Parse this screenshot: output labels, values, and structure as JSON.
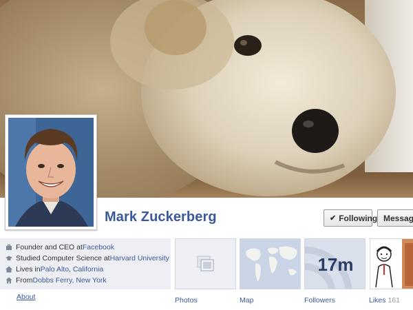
{
  "profile": {
    "name": "Mark Zuckerberg"
  },
  "actions": {
    "following_label": "Following",
    "message_label": "Message"
  },
  "info": [
    {
      "icon": "briefcase-icon",
      "prefix": "Founder and CEO at ",
      "link": "Facebook",
      "suffix": ""
    },
    {
      "icon": "graduation-cap-icon",
      "prefix": "Studied Computer Science at ",
      "link": "Harvard University",
      "suffix": ""
    },
    {
      "icon": "house-icon",
      "prefix": "Lives in ",
      "link": "Palo Alto, California",
      "suffix": ""
    },
    {
      "icon": "home-town-icon",
      "prefix": "From ",
      "link": "Dobbs Ferry, New York",
      "suffix": ""
    }
  ],
  "about_label": "About",
  "tiles": {
    "photos_label": "Photos",
    "map_label": "Map",
    "followers_label": "Followers",
    "followers_count": "17m",
    "likes_label": "Likes",
    "likes_count": "161"
  },
  "colors": {
    "link": "#3b5998",
    "panel": "#edeff4"
  }
}
